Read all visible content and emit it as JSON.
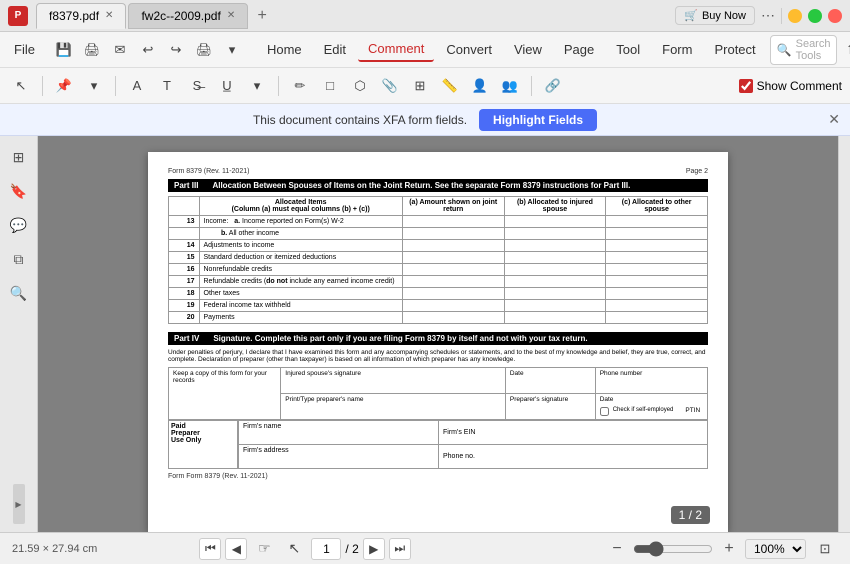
{
  "titlebar": {
    "app_icon": "P",
    "tab1_title": "f8379.pdf",
    "tab2_title": "fw2c--2009.pdf",
    "buy_now": "Buy Now",
    "more_icon": "⋯"
  },
  "menubar": {
    "file": "File",
    "home": "Home",
    "edit": "Edit",
    "comment": "Comment",
    "convert": "Convert",
    "view": "View",
    "page": "Page",
    "tool": "Tool",
    "form": "Form",
    "protect": "Protect",
    "search_placeholder": "Search Tools"
  },
  "toolbar": {
    "show_comment_label": "Show Comment"
  },
  "xfa_banner": {
    "message": "This document contains XFA form fields.",
    "highlight_btn": "Highlight Fields"
  },
  "pdf": {
    "form_label": "Form 8379 (Rev. 11-2021)",
    "page_num": "Page 2",
    "part3": {
      "badge": "Part III",
      "title": "Allocation Between Spouses of Items on the Joint Return.",
      "subtitle": "See the separate Form 8379 instructions for Part III.",
      "col_a": "Allocated Items",
      "col_a_sub": "(Column (a) must equal columns (b) + (c))",
      "col_b": "(a) Amount shown on joint return",
      "col_c": "(b) Allocated to injured spouse",
      "col_d": "(c) Allocated to other spouse",
      "rows": [
        {
          "num": "13",
          "label": "Income:",
          "sub": "a.",
          "sub_label": "Income reported on Form(s) W-2"
        },
        {
          "num": "",
          "label": "",
          "sub": "b.",
          "sub_label": "All other income"
        },
        {
          "num": "14",
          "label": "Adjustments to income",
          "sub": "",
          "sub_label": ""
        },
        {
          "num": "15",
          "label": "Standard deduction or itemized deductions",
          "sub": "",
          "sub_label": ""
        },
        {
          "num": "16",
          "label": "Nonrefundable credits",
          "sub": "",
          "sub_label": ""
        },
        {
          "num": "17",
          "label": "Refundable credits (do not include any earned income credit)",
          "sub": "",
          "sub_label": ""
        },
        {
          "num": "18",
          "label": "Other taxes",
          "sub": "",
          "sub_label": ""
        },
        {
          "num": "19",
          "label": "Federal income tax withheld",
          "sub": "",
          "sub_label": ""
        },
        {
          "num": "20",
          "label": "Payments",
          "sub": "",
          "sub_label": ""
        }
      ]
    },
    "part4": {
      "badge": "Part IV",
      "title": "Signature.",
      "description": "Complete this part only if you are filing Form 8379 by itself and not with your tax return.",
      "penalty_text": "Under penalties of perjury, I declare that I have examined this form and any accompanying schedules or statements, and to the best of my knowledge and belief, they are true, correct, and complete. Declaration of preparer (other than taxpayer) is based on all information of which preparer has any knowledge."
    },
    "signature_section": {
      "copy_label": "Keep a copy of this form for your records",
      "injured_sig": "Injured spouse's signature",
      "date": "Date",
      "phone": "Phone number",
      "preparer_name": "Print/Type preparer's name",
      "preparer_sig": "Preparer's signature",
      "prep_date": "Date",
      "check_label": "Check if self-employed",
      "ptin": "PTIN"
    },
    "paid_section": {
      "label1": "Paid",
      "label2": "Preparer",
      "label3": "Use Only",
      "firm_name": "Firm's name",
      "firm_ein": "Firm's EIN",
      "firm_address": "Firm's address",
      "phone_no": "Phone no."
    },
    "bottom_label": "Form 8379 (Rev. 11-2021)"
  },
  "footer": {
    "dimensions": "21.59 × 27.94 cm",
    "page_current": "1",
    "page_total": "/ 2",
    "page_badge": "1 / 2",
    "zoom_level": "100%"
  }
}
